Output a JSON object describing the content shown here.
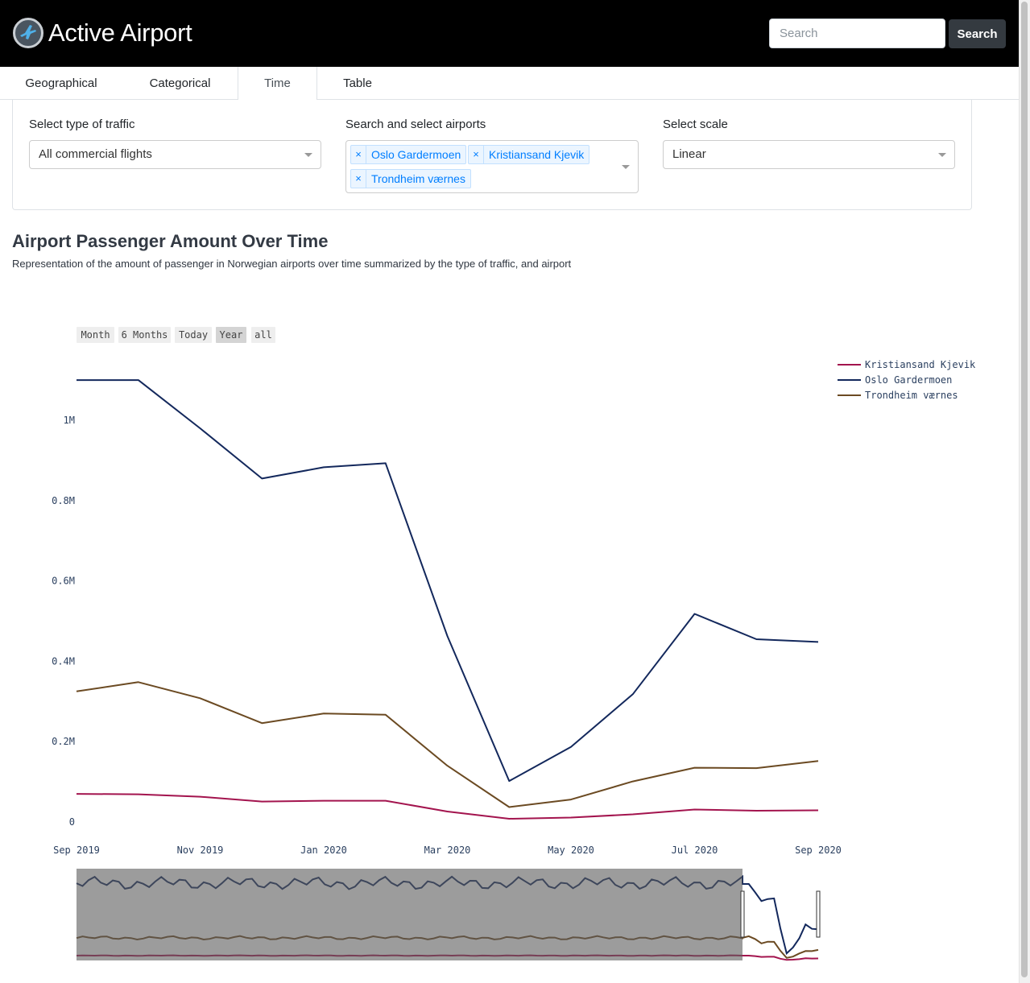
{
  "header": {
    "brand_title": "Active Airport",
    "search_placeholder": "Search",
    "search_button": "Search"
  },
  "tabs": [
    {
      "label": "Geographical",
      "active": false
    },
    {
      "label": "Categorical",
      "active": false
    },
    {
      "label": "Time",
      "active": true
    },
    {
      "label": "Table",
      "active": false
    }
  ],
  "filters": {
    "traffic_label": "Select type of traffic",
    "traffic_value": "All commercial flights",
    "airports_label": "Search and select airports",
    "airports_selected": [
      "Oslo Gardermoen",
      "Kristiansand Kjevik",
      "Trondheim værnes"
    ],
    "scale_label": "Select scale",
    "scale_value": "Linear"
  },
  "section": {
    "title": "Airport Passenger Amount Over Time",
    "subtitle": "Representation of the amount of passenger in Norwegian airports over time summarized by the type of traffic, and airport"
  },
  "chart_data": {
    "type": "line",
    "range_selector": {
      "buttons": [
        "Month",
        "6 Months",
        "Today",
        "Year",
        "all"
      ],
      "active": "Year"
    },
    "x": [
      "2019-09",
      "2019-10",
      "2019-11",
      "2019-12",
      "2020-01",
      "2020-02",
      "2020-03",
      "2020-04",
      "2020-05",
      "2020-06",
      "2020-07",
      "2020-08",
      "2020-09"
    ],
    "x_tick_labels": [
      "Sep 2019",
      "Nov 2019",
      "Jan 2020",
      "Mar 2020",
      "May 2020",
      "Jul 2020",
      "Sep 2020"
    ],
    "y_tick_labels": [
      "0",
      "0.2M",
      "0.4M",
      "0.6M",
      "0.8M",
      "1M"
    ],
    "ylim": [
      0,
      1200000
    ],
    "series": [
      {
        "name": "Kristiansand Kjevik",
        "color": "#a3144e",
        "values": [
          70000,
          69000,
          63000,
          51000,
          53000,
          53000,
          26000,
          8000,
          11000,
          19000,
          31000,
          28000,
          29000
        ]
      },
      {
        "name": "Oslo Gardermoen",
        "color": "#13285c",
        "values": [
          1100000,
          1100000,
          980000,
          855000,
          883000,
          893000,
          463000,
          102000,
          187000,
          318000,
          518000,
          455000,
          448000
        ]
      },
      {
        "name": "Trondheim værnes",
        "color": "#6b4a22",
        "values": [
          325000,
          348000,
          308000,
          246000,
          270000,
          267000,
          140000,
          37000,
          56000,
          101000,
          135000,
          134000,
          152000
        ]
      }
    ],
    "legend_position": "top-right",
    "grid": false,
    "range_slider": true
  }
}
